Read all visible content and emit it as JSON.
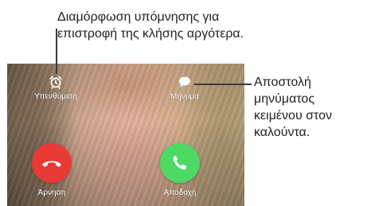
{
  "callouts": {
    "remind": [
      "Διαμόρφωση υπόμνησης για",
      "επιστροφή της κλήσης αργότερα."
    ],
    "message": [
      "Αποστολή",
      "μηνύματος",
      "κειμένου στον",
      "καλούντα."
    ]
  },
  "call_screen": {
    "remind_label": "Υπενθύμιση",
    "message_label": "Μήνυμα",
    "decline_label": "Άρνηση",
    "accept_label": "Αποδοχή",
    "icons": {
      "remind": "alarm-clock-icon",
      "message": "speech-bubble-icon",
      "decline": "phone-hangup-icon",
      "accept": "phone-icon"
    },
    "colors": {
      "decline": "#e83b36",
      "accept": "#4cd964",
      "label": "#ffffff"
    }
  }
}
